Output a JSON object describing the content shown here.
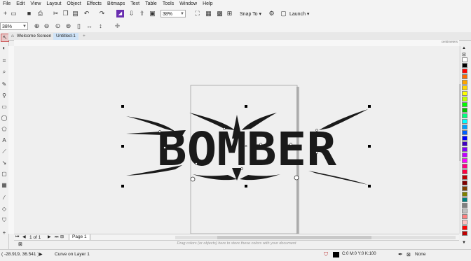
{
  "menu": [
    "File",
    "Edit",
    "View",
    "Layout",
    "Object",
    "Effects",
    "Bitmaps",
    "Text",
    "Table",
    "Tools",
    "Window",
    "Help"
  ],
  "toolbar": {
    "zoom_value": "38%",
    "snap_label": "Snap To",
    "launch_label": "Launch"
  },
  "property_bar": {
    "zoom_value": "38%"
  },
  "tabs": {
    "welcome": "Welcome Screen",
    "untitled": "Untitled-1"
  },
  "ruler": {
    "unit": "centimeters"
  },
  "canvas": {
    "artwork_text": "BOMBER"
  },
  "page_nav": {
    "current": "1",
    "of_label": "of",
    "total": "1",
    "page_tab": "Page 1"
  },
  "hint_text": "Drag colors (or objects) here to store these colors with your document",
  "status": {
    "coords": "( -28.919, 36.541 )",
    "object_info": "Curve on Layer 1",
    "fill_info": "C:0 M:0 Y:0 K:100",
    "outline_info": "None"
  },
  "colors": {
    "accent": "#6a2fb0",
    "selection": "#000000",
    "palette": [
      "#ffffff",
      "#000000",
      "#ff0000",
      "#ff6a00",
      "#ffa500",
      "#ffd700",
      "#ffff00",
      "#c0ff00",
      "#00ff00",
      "#00c000",
      "#00ff80",
      "#00ffff",
      "#00a0ff",
      "#0060ff",
      "#0000ff",
      "#4000c0",
      "#8000ff",
      "#c000ff",
      "#ff00ff",
      "#ff0080",
      "#ff0040",
      "#c00000",
      "#800000",
      "#804000",
      "#808000",
      "#008080",
      "#808080",
      "#c0c0c0",
      "#ff8080",
      "#ffc0c0",
      "#ff0000",
      "#c00000"
    ]
  }
}
